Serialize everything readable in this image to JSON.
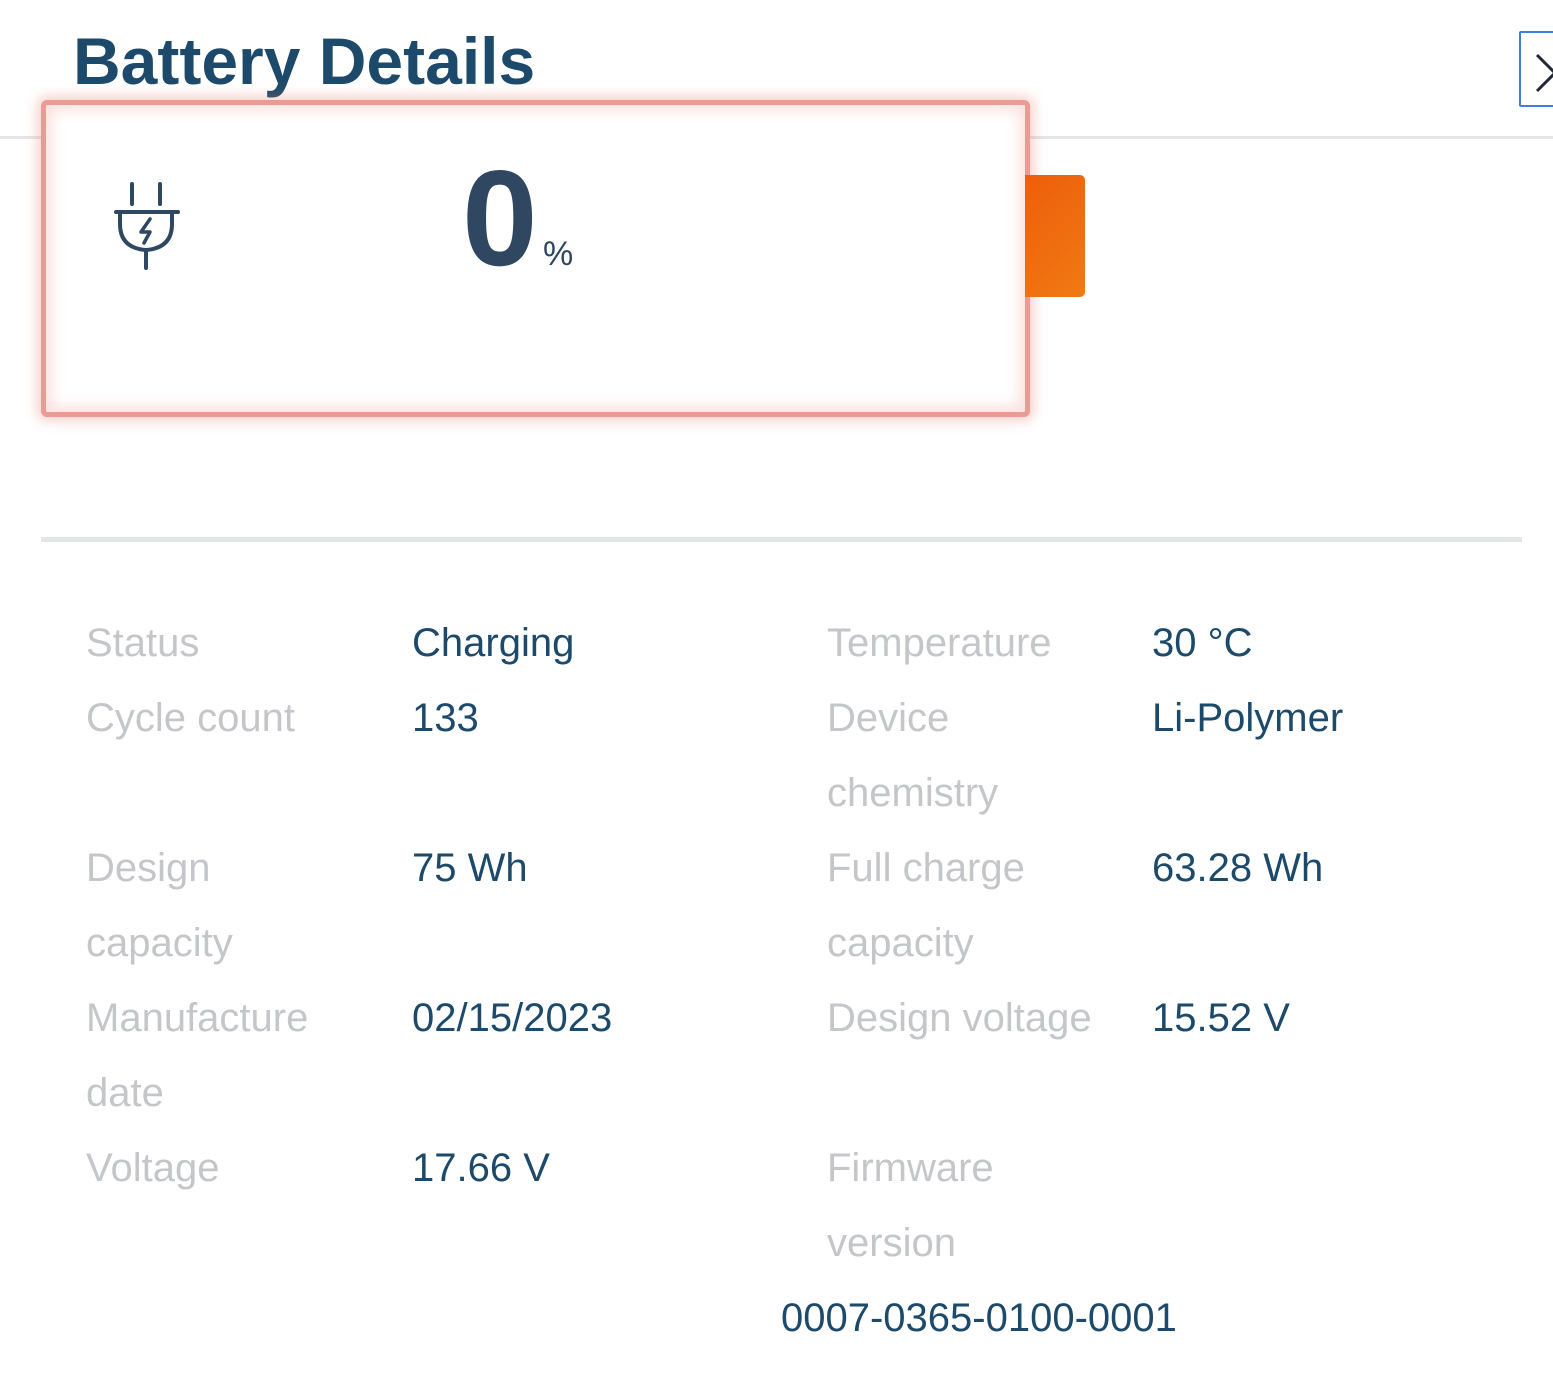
{
  "header": {
    "title": "Battery Details"
  },
  "battery": {
    "percent": "0",
    "percent_unit": "%",
    "level_fraction": 0,
    "plug_icon": "plug-charging-icon",
    "colors": {
      "outline": "#e99b94",
      "cap": "#ee5e0a",
      "text": "#2f4760"
    }
  },
  "details": {
    "status": {
      "label": "Status",
      "value": "Charging"
    },
    "cycle_count": {
      "label": "Cycle count",
      "value": "133"
    },
    "design_capacity": {
      "label_line1": "Design",
      "label_line2": "capacity",
      "value": "75 Wh"
    },
    "manufacture_date": {
      "label_line1": "Manufacture",
      "label_line2": "date",
      "value": "02/15/2023"
    },
    "voltage": {
      "label": "Voltage",
      "value": "17.66 V"
    },
    "temperature": {
      "label": "Temperature",
      "value": "30 °C"
    },
    "device_chemistry": {
      "label_line1": "Device",
      "label_line2": "chemistry",
      "value": "Li-Polymer"
    },
    "full_charge_capacity": {
      "label_line1": "Full charge",
      "label_line2": "capacity",
      "value": "63.28 Wh"
    },
    "design_voltage": {
      "label": "Design voltage",
      "value": "15.52 V"
    },
    "firmware_version": {
      "label_line1": "Firmware",
      "label_line2": "version",
      "value": "0007-0365-0100-0001"
    }
  }
}
